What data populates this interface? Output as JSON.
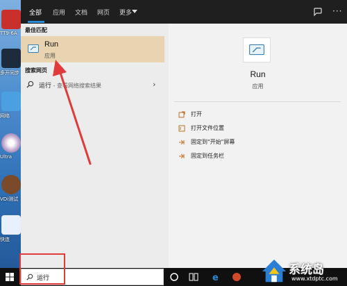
{
  "desktop": {
    "icons": [
      {
        "label": "TT9-6A"
      },
      {
        "label": "多开同步"
      },
      {
        "label": "网络"
      },
      {
        "label": "Ultra"
      },
      {
        "label": "VDi测试"
      },
      {
        "label": "快连"
      }
    ]
  },
  "search_panel": {
    "tabs": [
      {
        "label": "全部"
      },
      {
        "label": "应用"
      },
      {
        "label": "文档"
      },
      {
        "label": "网页"
      },
      {
        "label": "更多"
      }
    ],
    "best_match_heading": "最佳匹配",
    "best_match": {
      "title": "Run",
      "subtitle": "应用",
      "icon": "run-app-icon"
    },
    "web_heading": "搜索网页",
    "web_result": {
      "query": "运行",
      "suffix": " - 查看网络搜索结果"
    },
    "detail": {
      "title": "Run",
      "subtitle": "应用",
      "actions": [
        {
          "label": "打开",
          "icon": "open-icon"
        },
        {
          "label": "打开文件位置",
          "icon": "folder-location-icon"
        },
        {
          "label": "固定到\"开始\"屏幕",
          "icon": "pin-start-icon"
        },
        {
          "label": "固定到任务栏",
          "icon": "pin-taskbar-icon"
        }
      ]
    }
  },
  "taskbar": {
    "search_value": "运行"
  },
  "watermark": {
    "title": "系统岛",
    "url": "www.xtdptc.com"
  },
  "colors": {
    "accent": "#2a8ad4",
    "highlight": "#e8d4b0",
    "annotation": "#e03a3a"
  }
}
